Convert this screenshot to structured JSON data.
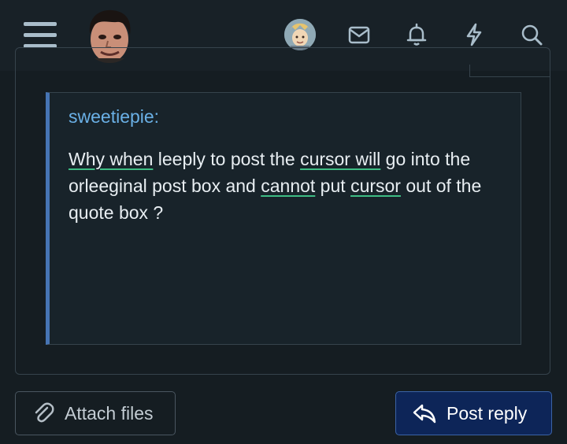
{
  "topbar": {
    "icons": [
      "menu-icon",
      "site-logo-avatar",
      "user-avatar",
      "inbox-icon",
      "bell-icon",
      "lightning-icon",
      "search-icon"
    ]
  },
  "quote": {
    "author": "sweetiepie:",
    "line_segments": [
      {
        "text": "Why when",
        "spell": true
      },
      {
        "text": " leeply to post the ",
        "spell": false
      },
      {
        "text": "cursor will",
        "spell": true
      },
      {
        "text": " go into the orleeginal post box and ",
        "spell": false
      },
      {
        "text": "cannot",
        "spell": true
      },
      {
        "text": " put ",
        "spell": false
      },
      {
        "text": "cursor",
        "spell": true
      },
      {
        "text": " out of the quote box ?",
        "spell": false
      }
    ]
  },
  "buttons": {
    "attach_label": "Attach files",
    "post_label": "Post reply"
  },
  "colors": {
    "background": "#151d22",
    "quote_accent": "#4674b4",
    "author": "#6ab0e6",
    "post_button": "#0d2558",
    "spellcheck_underline": "#3ebd84"
  }
}
